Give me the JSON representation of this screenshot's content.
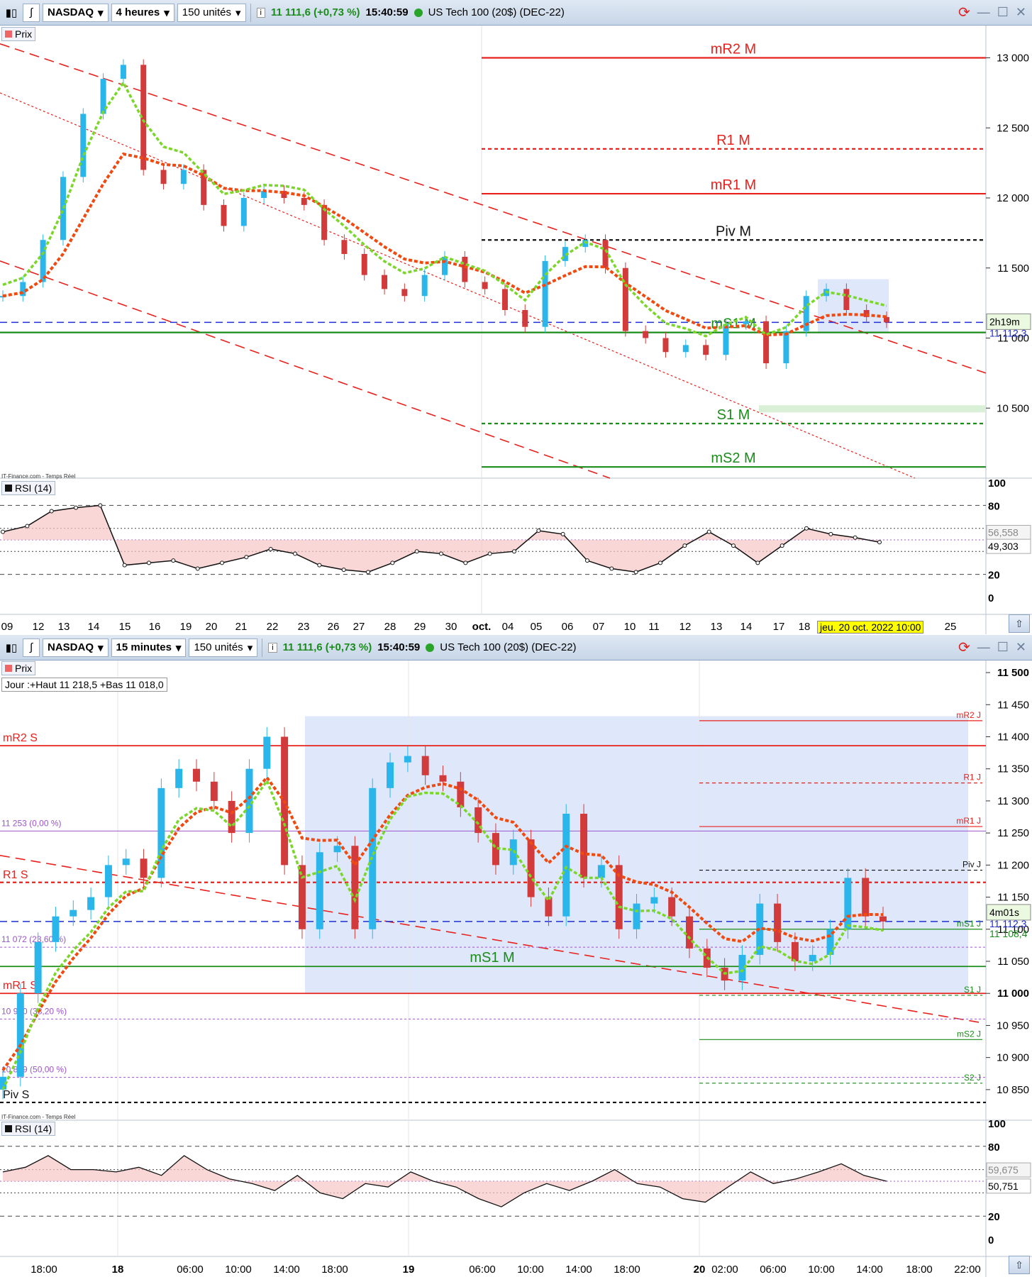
{
  "colors": {
    "up": "#2ab6ea",
    "down": "#d23b3b",
    "red": "#e8211d",
    "green": "#1a8c1a",
    "purple": "#9b55c9",
    "black": "#111111",
    "blue": "#1d2fd6",
    "ema_red": "#f04a10",
    "ema_green": "#7bd62a",
    "highlight": "#dfe8fb"
  },
  "toolbar_top": {
    "symbol": "NASDAQ",
    "period": "4 heures",
    "units": "150 unités",
    "last": "11 111,6 (+0,73 %)",
    "time": "15:40:59",
    "instrument": "US Tech 100 (20$) (DEC-22)"
  },
  "toolbar_bottom": {
    "symbol": "NASDAQ",
    "period": "15 minutes",
    "units": "150 unités",
    "last": "11 111,6 (+0,73 %)",
    "time": "15:40:59",
    "instrument": "US Tech 100 (20$) (DEC-22)"
  },
  "top": {
    "price_tag": "Prix",
    "credit": "IT-Finance.com - Temps Réel",
    "rsi_tag": "RSI (14)",
    "countdown": "2h19m",
    "last_label": "11 112,3",
    "rsi_val1": "56,558",
    "rsi_val2": "49,303",
    "date_badge": "jeu. 20 oct. 2022 10:00",
    "x_labels": [
      "09",
      "12",
      "13",
      "14",
      "15",
      "16",
      "19",
      "20",
      "21",
      "22",
      "23",
      "26",
      "27",
      "28",
      "29",
      "30",
      "oct.",
      "04",
      "05",
      "06",
      "07",
      "10",
      "11",
      "12",
      "13",
      "14",
      "17",
      "18",
      "25"
    ],
    "y_labels": [
      "13 000",
      "12 500",
      "12 000",
      "11 500",
      "11 000",
      "10 500"
    ],
    "rsi_y": [
      "100",
      "80",
      "20",
      "0"
    ],
    "levels": [
      {
        "name": "mR2 M",
        "value": 13000,
        "color": "#e8211d",
        "style": "solid"
      },
      {
        "name": "R1 M",
        "value": 12350,
        "color": "#e8211d",
        "style": "dot"
      },
      {
        "name": "mR1 M",
        "value": 12030,
        "color": "#e8211d",
        "style": "solid"
      },
      {
        "name": "Piv M",
        "value": 11700,
        "color": "#111111",
        "style": "dot"
      },
      {
        "name": "mS1 M",
        "value": 11040,
        "color": "#1a8c1a",
        "style": "solid"
      },
      {
        "name": "S1 M",
        "value": 10390,
        "color": "#1a8c1a",
        "style": "dot"
      },
      {
        "name": "mS2 M",
        "value": 10080,
        "color": "#1a8c1a",
        "style": "solid"
      }
    ]
  },
  "bottom": {
    "price_tag": "Prix",
    "credit": "IT-Finance.com - Temps Réel",
    "rsi_tag": "RSI (14)",
    "info": "Jour :+Haut 11 218,5 +Bas 11 018,0",
    "countdown": "4m01s",
    "last_label": "11 112,3",
    "sub_label": "11 108,4",
    "rsi_val1": "59,675",
    "rsi_val2": "50,751",
    "x_labels": [
      "18:00",
      "18",
      "06:00",
      "10:00",
      "14:00",
      "18:00",
      "19",
      "06:00",
      "10:00",
      "14:00",
      "18:00",
      "20",
      "02:00",
      "06:00",
      "10:00",
      "14:00",
      "18:00",
      "22:00"
    ],
    "y_labels": [
      "11 500",
      "11 450",
      "11 400",
      "11 350",
      "11 300",
      "11 250",
      "11 200",
      "11 150",
      "11 100",
      "11 050",
      "11 000",
      "10 950",
      "10 900",
      "10 850"
    ],
    "rsi_y": [
      "100",
      "80",
      "20",
      "0"
    ],
    "levels_left": [
      {
        "name": "mR2 S",
        "value": 11386,
        "color": "#e8211d",
        "style": "solid"
      },
      {
        "name": "R1 S",
        "value": 11173,
        "color": "#e8211d",
        "style": "dot"
      },
      {
        "name": "mR1 S",
        "value": 11000,
        "color": "#e8211d",
        "style": "solid"
      },
      {
        "name": "Piv S",
        "value": 10830,
        "color": "#111111",
        "style": "dot"
      },
      {
        "name": "mS1 M",
        "value": 11042,
        "color": "#1a8c1a",
        "style": "solid"
      }
    ],
    "fibo": [
      {
        "name": "11 253 (0,00 %)",
        "value": 11253
      },
      {
        "name": "11 072 (23,60 %)",
        "value": 11072
      },
      {
        "name": "10 960 (38,20 %)",
        "value": 10960
      },
      {
        "name": "10 869 (50,00 %)",
        "value": 10869
      }
    ],
    "levels_right": [
      {
        "name": "mR2 J",
        "value": 11425,
        "color": "#e8211d",
        "style": "solid"
      },
      {
        "name": "R1 J",
        "value": 11328,
        "color": "#e8211d",
        "style": "dot"
      },
      {
        "name": "mR1 J",
        "value": 11260,
        "color": "#e8211d",
        "style": "solid"
      },
      {
        "name": "Piv J",
        "value": 11192,
        "color": "#111111",
        "style": "dot"
      },
      {
        "name": "mS1 J",
        "value": 11100,
        "color": "#1a8c1a",
        "style": "solid"
      },
      {
        "name": "S1 J",
        "value": 10997,
        "color": "#1a8c1a",
        "style": "dot"
      },
      {
        "name": "mS2 J",
        "value": 10928,
        "color": "#1a8c1a",
        "style": "solid"
      },
      {
        "name": "S2 J",
        "value": 10860,
        "color": "#1a8c1a",
        "style": "dot"
      }
    ]
  },
  "chart_data": [
    {
      "type": "line",
      "title": "NASDAQ 4 heures",
      "series": [
        {
          "name": "Prix",
          "values": [
            11300,
            11400,
            11700,
            12150,
            12600,
            12850,
            12950,
            12200,
            12100,
            12200,
            11950,
            11800,
            12000,
            12050,
            12000,
            11950,
            11700,
            11600,
            11450,
            11350,
            11300,
            11450,
            11580,
            11400,
            11350,
            11200,
            11080,
            11550,
            11650,
            11700,
            11500,
            11050,
            11000,
            10900,
            10950,
            10880,
            11100,
            11120,
            10820,
            11050,
            11300,
            11350,
            11200,
            11150,
            11112
          ]
        },
        {
          "name": "RSI (14)",
          "values": [
            57,
            62,
            75,
            78,
            80,
            28,
            30,
            32,
            25,
            30,
            35,
            42,
            38,
            28,
            24,
            22,
            30,
            40,
            38,
            30,
            38,
            40,
            58,
            55,
            32,
            25,
            22,
            30,
            45,
            57,
            45,
            30,
            45,
            60,
            55,
            52,
            48
          ]
        }
      ]
    },
    {
      "type": "line",
      "title": "NASDAQ 15 minutes",
      "series": [
        {
          "name": "Prix",
          "values": [
            10870,
            11000,
            11080,
            11120,
            11130,
            11150,
            11200,
            11210,
            11180,
            11320,
            11350,
            11330,
            11300,
            11250,
            11350,
            11400,
            11200,
            11100,
            11220,
            11230,
            11100,
            11320,
            11360,
            11370,
            11340,
            11330,
            11290,
            11250,
            11200,
            11240,
            11150,
            11120,
            11280,
            11180,
            11200,
            11100,
            11140,
            11150,
            11120,
            11070,
            11040,
            11020,
            11060,
            11140,
            11080,
            11050,
            11060,
            11100,
            11180,
            11120,
            11112
          ]
        },
        {
          "name": "RSI (14)",
          "values": [
            58,
            62,
            72,
            60,
            60,
            58,
            62,
            55,
            72,
            60,
            52,
            48,
            42,
            55,
            40,
            35,
            48,
            45,
            58,
            50,
            45,
            35,
            28,
            40,
            48,
            42,
            50,
            60,
            48,
            45,
            35,
            32,
            45,
            58,
            48,
            52,
            58,
            65,
            55,
            50
          ]
        }
      ]
    }
  ]
}
